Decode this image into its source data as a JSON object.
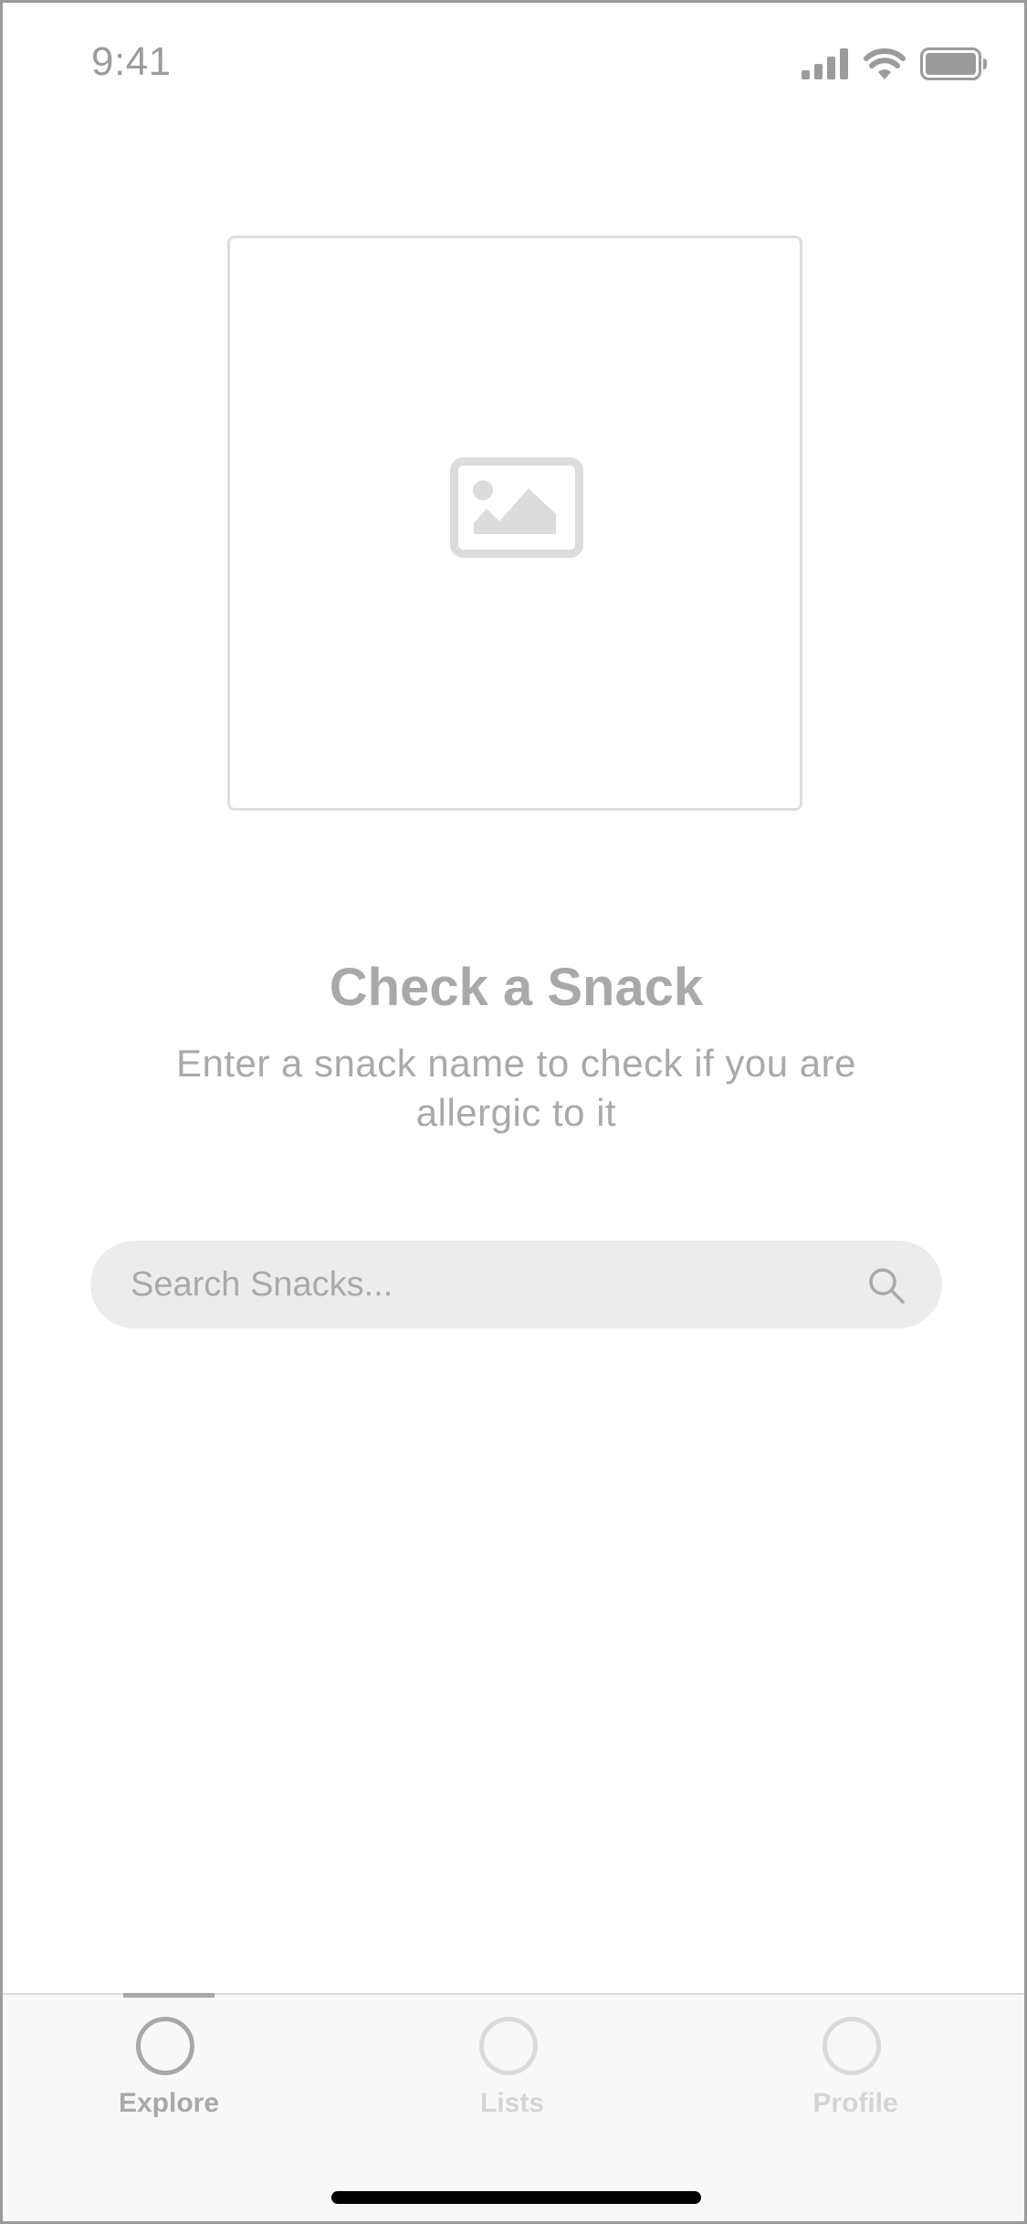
{
  "status_bar": {
    "time": "9:41",
    "icons": [
      "signal-icon",
      "wifi-icon",
      "battery-icon"
    ]
  },
  "hero": {
    "image_icon": "image-placeholder-icon"
  },
  "content": {
    "title": "Check a Snack",
    "subtitle": "Enter a snack name to check if you are allergic to it"
  },
  "search": {
    "placeholder": "Search Snacks...",
    "value": "",
    "icon": "search-icon"
  },
  "tabbar": {
    "active_tab": "Explore",
    "tabs": [
      {
        "label": "Explore",
        "icon": "circle-icon"
      },
      {
        "label": "Lists",
        "icon": "circle-icon"
      },
      {
        "label": "Profile",
        "icon": "circle-icon"
      }
    ]
  },
  "colors": {
    "text_muted": "#a9a9a9",
    "search_bg": "#ececec",
    "tabbar_bg": "#f8f8f8",
    "active_tab": "#a8a8a8",
    "inactive_tab": "#d4d4d4"
  }
}
